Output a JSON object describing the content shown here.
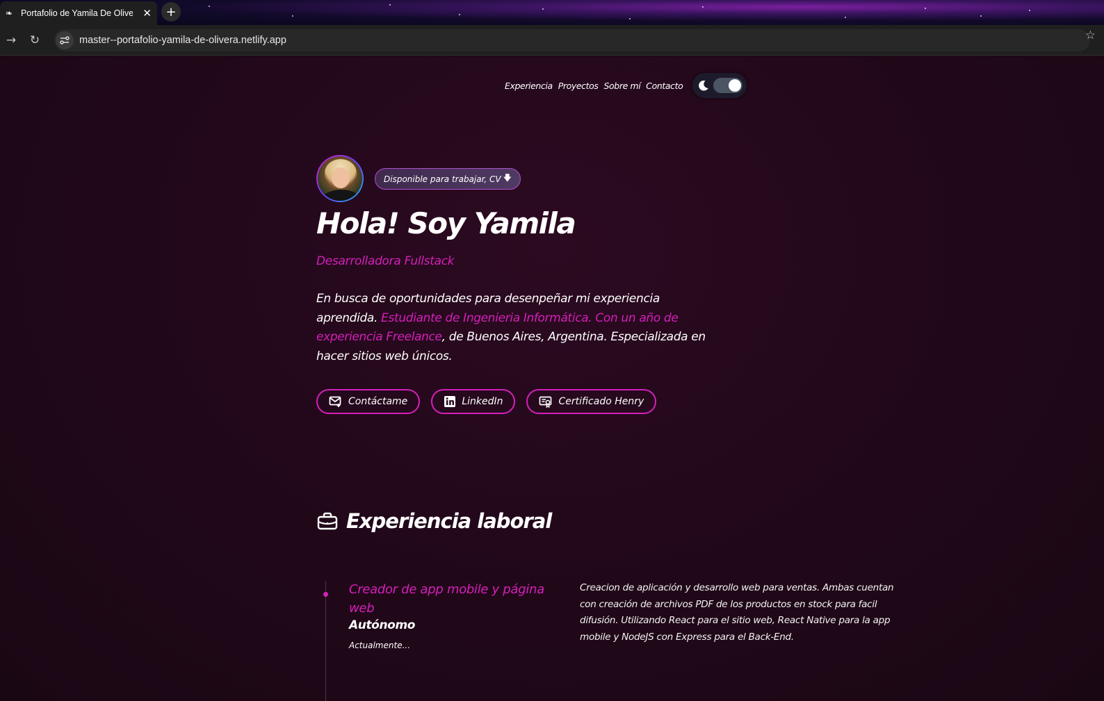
{
  "browser": {
    "tab_title": "Portafolio de Yamila De Olivera",
    "tab_close": "✕",
    "new_tab": "+",
    "url": "master--portafolio-yamila-de-olivera.netlify.app",
    "back_icon": "→",
    "reload_icon": "↻",
    "bookmark_icon": "☆"
  },
  "nav": {
    "items": [
      "Experiencia",
      "Proyectos",
      "Sobre mí",
      "Contacto"
    ],
    "theme_toggle": "dark"
  },
  "hero": {
    "badge": "Disponible para trabajar, CV",
    "badge_icon": "download-arrow-icon",
    "title": "Hola! Soy Yamila",
    "subtitle": "Desarrolladora Fullstack",
    "desc_part1": "En busca de oportunidades para desenpeñar mi experiencia aprendida. ",
    "desc_highlight": "Estudiante de Ingenieria Informática. Con un año de experiencia Freelance",
    "desc_part2": ", de Buenos Aires, Argentina. Especializada en hacer sitios web únicos.",
    "buttons": {
      "contact": "Contáctame",
      "linkedin": "LinkedIn",
      "certificate": "Certificado Henry"
    }
  },
  "experience": {
    "title": "Experiencia laboral",
    "jobs": [
      {
        "role": "Creador de app mobile y página web",
        "company": "Autónomo",
        "date": "Actualmente...",
        "description": "Creacion de aplicación y desarrollo web para ventas. Ambas cuentan con creación de archivos PDF de los productos en stock para facil difusión. Utilizando React para el sitio web, React Native para la app mobile y NodeJS con Express para el Back-End."
      }
    ]
  },
  "colors": {
    "accent": "#d61fbb",
    "background": "#1f0818",
    "toggle_bg": "#1d1b2b"
  }
}
